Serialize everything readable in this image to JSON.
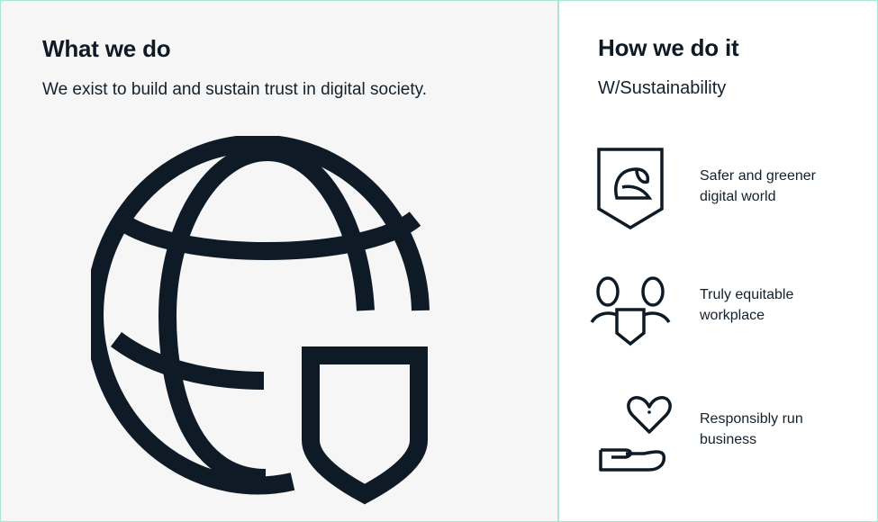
{
  "left": {
    "heading": "What we do",
    "subheading": "We exist to build and sustain trust in digital society."
  },
  "right": {
    "heading": "How we do it",
    "subheading": "W/Sustainability",
    "items": [
      {
        "icon": "leaf-shield-icon",
        "label": "Safer and greener digital world"
      },
      {
        "icon": "people-shield-icon",
        "label": "Truly equitable workplace"
      },
      {
        "icon": "hand-heart-icon",
        "label": "Responsibly run business"
      }
    ]
  },
  "colors": {
    "ink": "#0e1b26",
    "left_panel_bg": "#f6f6f6",
    "border_accent": "#a8e6cf",
    "background": "#ffffff"
  }
}
